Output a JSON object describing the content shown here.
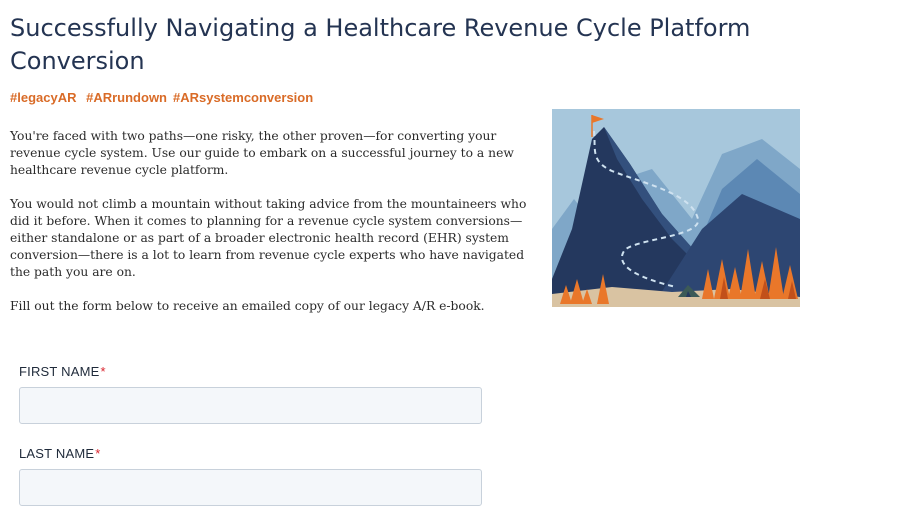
{
  "page": {
    "title": "Successfully Navigating a Healthcare Revenue Cycle Platform Conversion",
    "tags": [
      "#legacyAR",
      "#ARrundown",
      "#ARsystemconversion"
    ],
    "paragraphs": [
      "You're faced with two paths—one risky, the other proven—for converting your revenue cycle system. Use our guide to embark on a successful journey to a new healthcare revenue cycle platform.",
      "You would not climb a mountain without taking advice from the mountaineers who did it before. When it comes to planning for a revenue cycle system conversions—either standalone or as part of a broader electronic health record (EHR) system conversion—there is a lot to learn from revenue cycle experts who have navigated the path you are on.",
      "Fill out the form below to receive an emailed copy of our legacy A/R e-book."
    ]
  },
  "hero_image": {
    "icon": "mountain-summit-illustration",
    "colors": {
      "sky": "#a7c7dc",
      "mountain": "#24385e",
      "accent": "#e9772a",
      "ground": "#d9c3a2"
    }
  },
  "form": {
    "first_name": {
      "label": "FIRST NAME",
      "required_marker": "*",
      "value": "",
      "placeholder": ""
    },
    "last_name": {
      "label": "LAST NAME",
      "required_marker": "*",
      "value": "",
      "placeholder": ""
    }
  },
  "colors": {
    "title": "#243452",
    "tag": "#d96b27",
    "required": "#d9232d",
    "input_bg": "#f4f7fa"
  }
}
